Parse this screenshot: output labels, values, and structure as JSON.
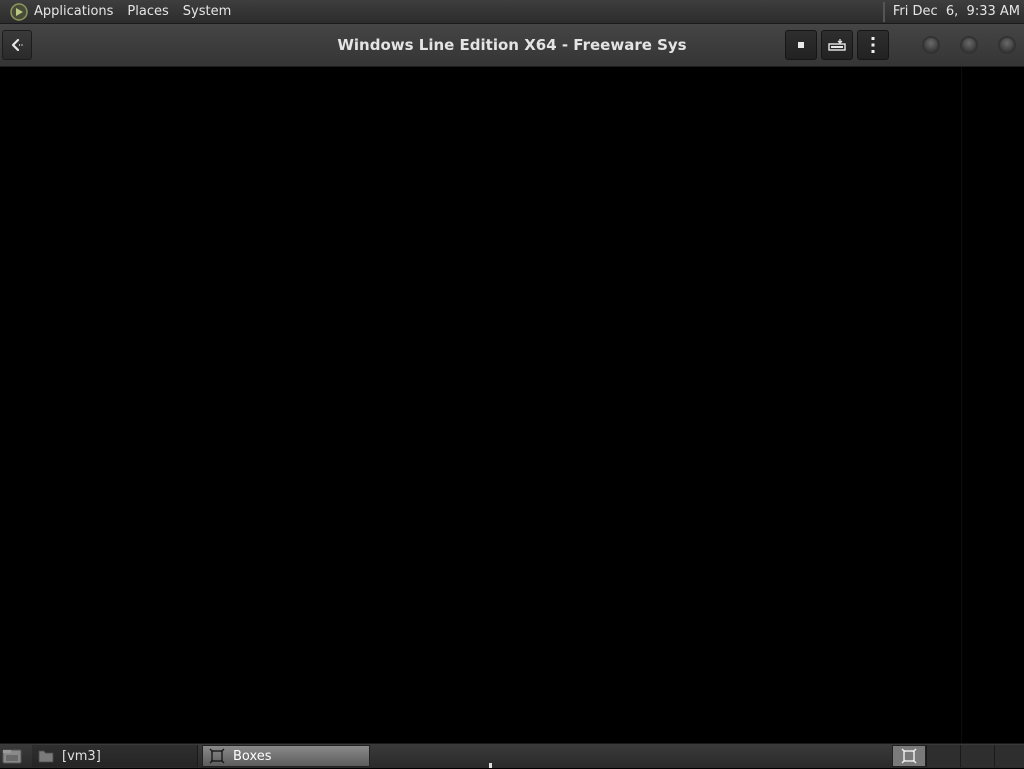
{
  "top_panel": {
    "menus": [
      "Applications",
      "Places",
      "System"
    ],
    "clock": "Fri Dec  6,  9:33 AM",
    "logo_icon": "distro-logo-icon"
  },
  "header": {
    "title": "Windows Line Edition X64 - Freeware Sys",
    "back_icon": "back-arrow-icon",
    "buttons": [
      {
        "name": "stop-button",
        "icon": "stop-square-icon"
      },
      {
        "name": "keyboard-button",
        "icon": "keyboard-send-icon"
      },
      {
        "name": "menu-button",
        "icon": "vertical-dots-icon"
      }
    ],
    "window_controls": [
      "minimize-icon",
      "maximize-icon",
      "close-icon"
    ]
  },
  "taskbar": {
    "tasks": [
      {
        "label": "[vm3]",
        "icon": "folder-icon",
        "active": false
      },
      {
        "label": "Boxes",
        "icon": "boxes-app-icon",
        "active": true
      }
    ],
    "workspaces_count": 4,
    "active_workspace": 1
  },
  "colors": {
    "panel": "#333333",
    "header": "#3d3d3d",
    "display": "#000000",
    "active_task": "#7a7a7a"
  }
}
